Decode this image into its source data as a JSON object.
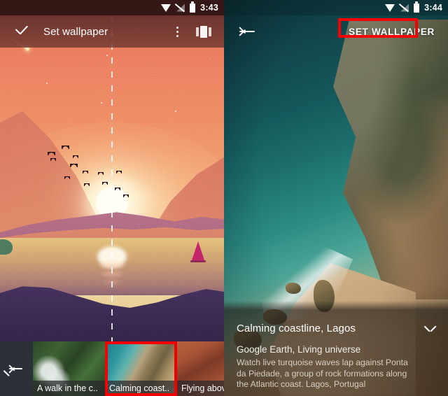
{
  "left_panel": {
    "status_bar": {
      "time": "3:43",
      "icons": [
        "wifi-icon",
        "signal-off-icon",
        "battery-icon"
      ]
    },
    "toolbar": {
      "confirm_icon": "check-icon",
      "title": "Set wallpaper",
      "overflow_icon": "overflow-menu-icon",
      "pages_icon": "multi-page-icon"
    },
    "wallpaper_preview": {
      "name": "Sunset mountains illustration",
      "crop_divider": "dashed-home-screen-divider"
    },
    "thumbnail_strip": {
      "back_icon": "back-arrow-icon",
      "items": [
        {
          "label": "A walk in the c..",
          "selected": false,
          "name": "thumbnail-forest"
        },
        {
          "label": "Calming coast..",
          "selected": true,
          "name": "thumbnail-coast"
        },
        {
          "label": "Flying above, .",
          "selected": false,
          "name": "thumbnail-canyon"
        }
      ],
      "selection_color": "#f40000"
    }
  },
  "right_panel": {
    "status_bar": {
      "time": "3:44",
      "icons": [
        "wifi-icon",
        "signal-off-icon",
        "battery-icon"
      ]
    },
    "toolbar": {
      "back_icon": "back-arrow-icon",
      "action_label": "SET WALLPAPER",
      "highlight_color": "#f40000"
    },
    "photo": {
      "name": "Aerial coastline photo, turquoise sea and cliffs"
    },
    "info_card": {
      "title": "Calming coastline, Lagos",
      "expand_icon": "chevron-down-icon",
      "source": "Google Earth, Living universe",
      "description": "Watch live turquoise waves lap against Ponta da Piedade, a group of rock formations along the Atlantic coast. Lagos, Portugal"
    }
  }
}
